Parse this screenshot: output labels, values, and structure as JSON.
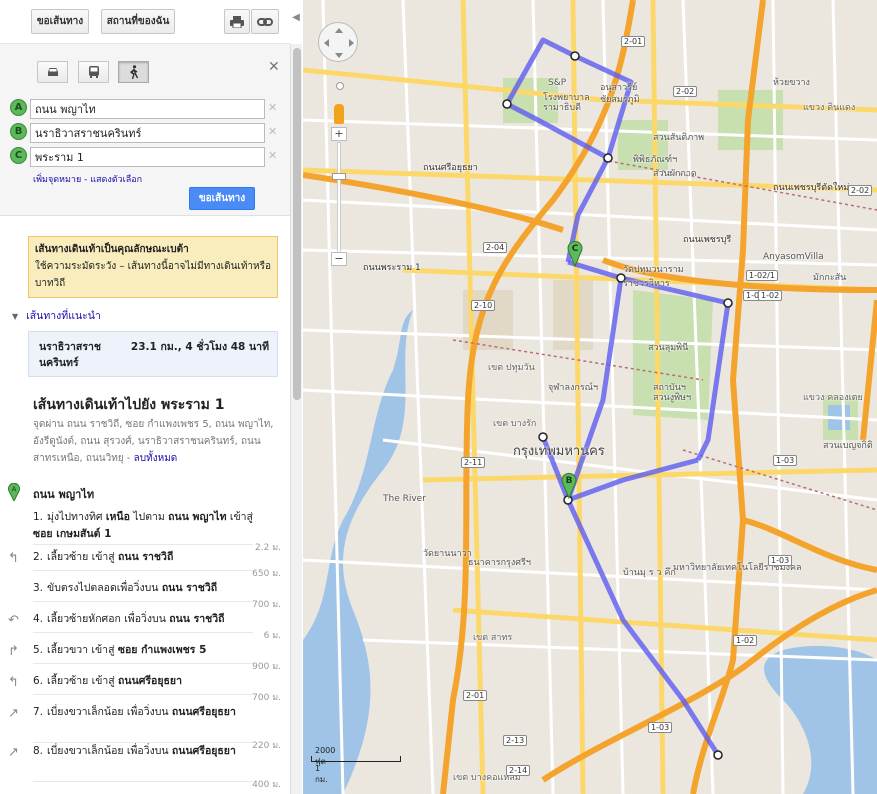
{
  "toolbar": {
    "directions_label": "ขอเส้นทาง",
    "myplaces_label": "สถานที่ของฉัน",
    "print_icon": "printer-icon",
    "link_icon": "link-icon"
  },
  "form": {
    "modes": [
      "car-icon",
      "transit-icon",
      "walk-icon"
    ],
    "selected_mode": "walk",
    "waypoints": [
      {
        "letter": "A",
        "value": "ถนน พญาไท"
      },
      {
        "letter": "B",
        "value": "นราธิวาสราชนครินทร์"
      },
      {
        "letter": "C",
        "value": "พระราม 1"
      }
    ],
    "add_destination": "เพิ่มจุดหมาย",
    "show_options": "แสดงตัวเลือก",
    "go_label": "ขอเส้นทาง"
  },
  "warning": {
    "title": "เส้นทางเดินเท้าเป็นคุณลักษณะเบต้า",
    "body": "ใช้ความระมัดระวัง – เส้นทางนี้อาจไม่มีทางเดินเท้าหรือบาทวิถี"
  },
  "suggested": {
    "label": "เส้นทางที่แนะนำ",
    "destination": "นราธิวาสราชนครินทร์",
    "distance_time": "23.1 กม., 4 ชั่วโมง 48 นาที"
  },
  "route": {
    "title": "เส้นทางเดินเท้าไปยัง พระราม 1",
    "via": "จุดผ่าน ถนน ราชวิถี, ซอย กำแพงเพชร 5, ถนน พญาไท, อังรีดูนังต์, ถนน สุรวงศ์, นราธิวาสราชนครินทร์, ถนน สาทรเหนือ, ถนนวิทยุ -",
    "hide_all": "ลบทั้งหมด",
    "start_letter": "A",
    "start_label": "ถนน พญาไท",
    "steps": [
      {
        "n": "1.",
        "text": "มุ่งไปทางทิศ ",
        "b1": "เหนือ",
        "mid": " ไปตาม ",
        "b2": "ถนน พญาไท",
        "tail": " เข้าสู่ ",
        "b3": "ซอย เกษมสันต์ 1",
        "dist": "2.2 ม.",
        "icon": "none"
      },
      {
        "n": "2.",
        "text": "เลี้ยวซ้าย เข้าสู่ ",
        "b1": "ถนน ราชวิถี",
        "dist": "650 ม.",
        "icon": "turn-left-icon"
      },
      {
        "n": "3.",
        "text": "ขับตรงไปตลอดเพื่อวิ่งบน ",
        "b1": "ถนน ราชวิถี",
        "dist": "700 ม.",
        "icon": "none"
      },
      {
        "n": "4.",
        "text": "เลี้ยวซ้ายหักศอก เพื่อวิ่งบน ",
        "b1": "ถนน ราชวิถี",
        "dist": "6 ม.",
        "icon": "sharp-left-icon"
      },
      {
        "n": "5.",
        "text": "เลี้ยวขวา เข้าสู่ ",
        "b1": "ซอย กำแพงเพชร 5",
        "dist": "900 ม.",
        "icon": "turn-right-icon"
      },
      {
        "n": "6.",
        "text": "เลี้ยวซ้าย เข้าสู่ ",
        "b1": "ถนนศรีอยุธยา",
        "dist": "700 ม.",
        "icon": "turn-left-icon"
      },
      {
        "n": "7.",
        "text": "เบี่ยงขวาเล็กน้อย เพื่อวิ่งบน ",
        "b1": "ถนนศรีอยุธยา",
        "dist": "220 ม.",
        "icon": "slight-right-icon"
      },
      {
        "n": "8.",
        "text": "เบี่ยงขวาเล็กน้อย เพื่อวิ่งบน ",
        "b1": "ถนนศรีอยุธยา",
        "dist": "400 ม.",
        "icon": "slight-right-icon"
      }
    ]
  },
  "map": {
    "labels": [
      {
        "t": "S&P",
        "k": "poi"
      },
      {
        "t": "โรงพยาบาล",
        "k": "poi"
      },
      {
        "t": "รามาธิบดี",
        "k": "poi"
      },
      {
        "t": "อนุสาวรีย์",
        "k": "poi"
      },
      {
        "t": "ชัยสมรภูมิ",
        "k": "poi"
      },
      {
        "t": "สวนสันติภาพ",
        "k": "poi"
      },
      {
        "t": "พิพิธภัณฑ์ฯ",
        "k": "poi"
      },
      {
        "t": "สวนผักกาด",
        "k": "poi"
      },
      {
        "t": "ถนนศรีอยุธยา",
        "k": "road"
      },
      {
        "t": "ถนนเพชรบุรี",
        "k": "road"
      },
      {
        "t": "ถนนพระราม 1",
        "k": "road"
      },
      {
        "t": "AnyasomVilla",
        "k": "poi"
      },
      {
        "t": "วัดปทุมวนาราม",
        "k": "poi"
      },
      {
        "t": "ราชวรวิหาร",
        "k": "poi"
      },
      {
        "t": "สวนลุมพินี",
        "k": "poi"
      },
      {
        "t": "สวนงูพิษฯ",
        "k": "poi"
      },
      {
        "t": "สถาบันฯ",
        "k": "poi"
      },
      {
        "t": "จุฬาลงกรณ์ฯ",
        "k": "poi"
      },
      {
        "t": "กรุงเทพมหานคร",
        "k": "city"
      },
      {
        "t": "เขต ปทุมวัน",
        "k": "district"
      },
      {
        "t": "เขต บางรัก",
        "k": "district"
      },
      {
        "t": "เขต สาทร",
        "k": "district"
      },
      {
        "t": "เขต บางคอแหลม",
        "k": "district"
      },
      {
        "t": "The River",
        "k": "poi"
      },
      {
        "t": "วัดยานนาวา",
        "k": "poi"
      },
      {
        "t": "มหาวิทยาลัยเทคโนโลยีราชมงคล",
        "k": "poi"
      },
      {
        "t": "ธนาคารกรุงศรีฯ",
        "k": "poi"
      },
      {
        "t": "บ้านมุ ร ว คึก",
        "k": "poi"
      },
      {
        "t": "ห้วยขวาง",
        "k": "poi"
      },
      {
        "t": "ถนนเพชรบุรีตัดใหม่",
        "k": "road"
      },
      {
        "t": "มักกะสัน",
        "k": "poi"
      },
      {
        "t": "แขวง ดินแดง",
        "k": "district"
      },
      {
        "t": "แขวง คลองเตย",
        "k": "district"
      },
      {
        "t": "สวนเบญจกิติ",
        "k": "poi"
      }
    ],
    "shields": [
      "2-01",
      "2-02",
      "2-02",
      "1-02",
      "1-02/1",
      "1-02",
      "2-10",
      "2-11",
      "2-13",
      "2-14",
      "2-01",
      "1-03",
      "1-03",
      "1-02",
      "1-03",
      "2-04"
    ],
    "scale_ft": "2000 ฟุต",
    "scale_km": "1 กม.",
    "markers": [
      "A",
      "B",
      "C"
    ]
  }
}
